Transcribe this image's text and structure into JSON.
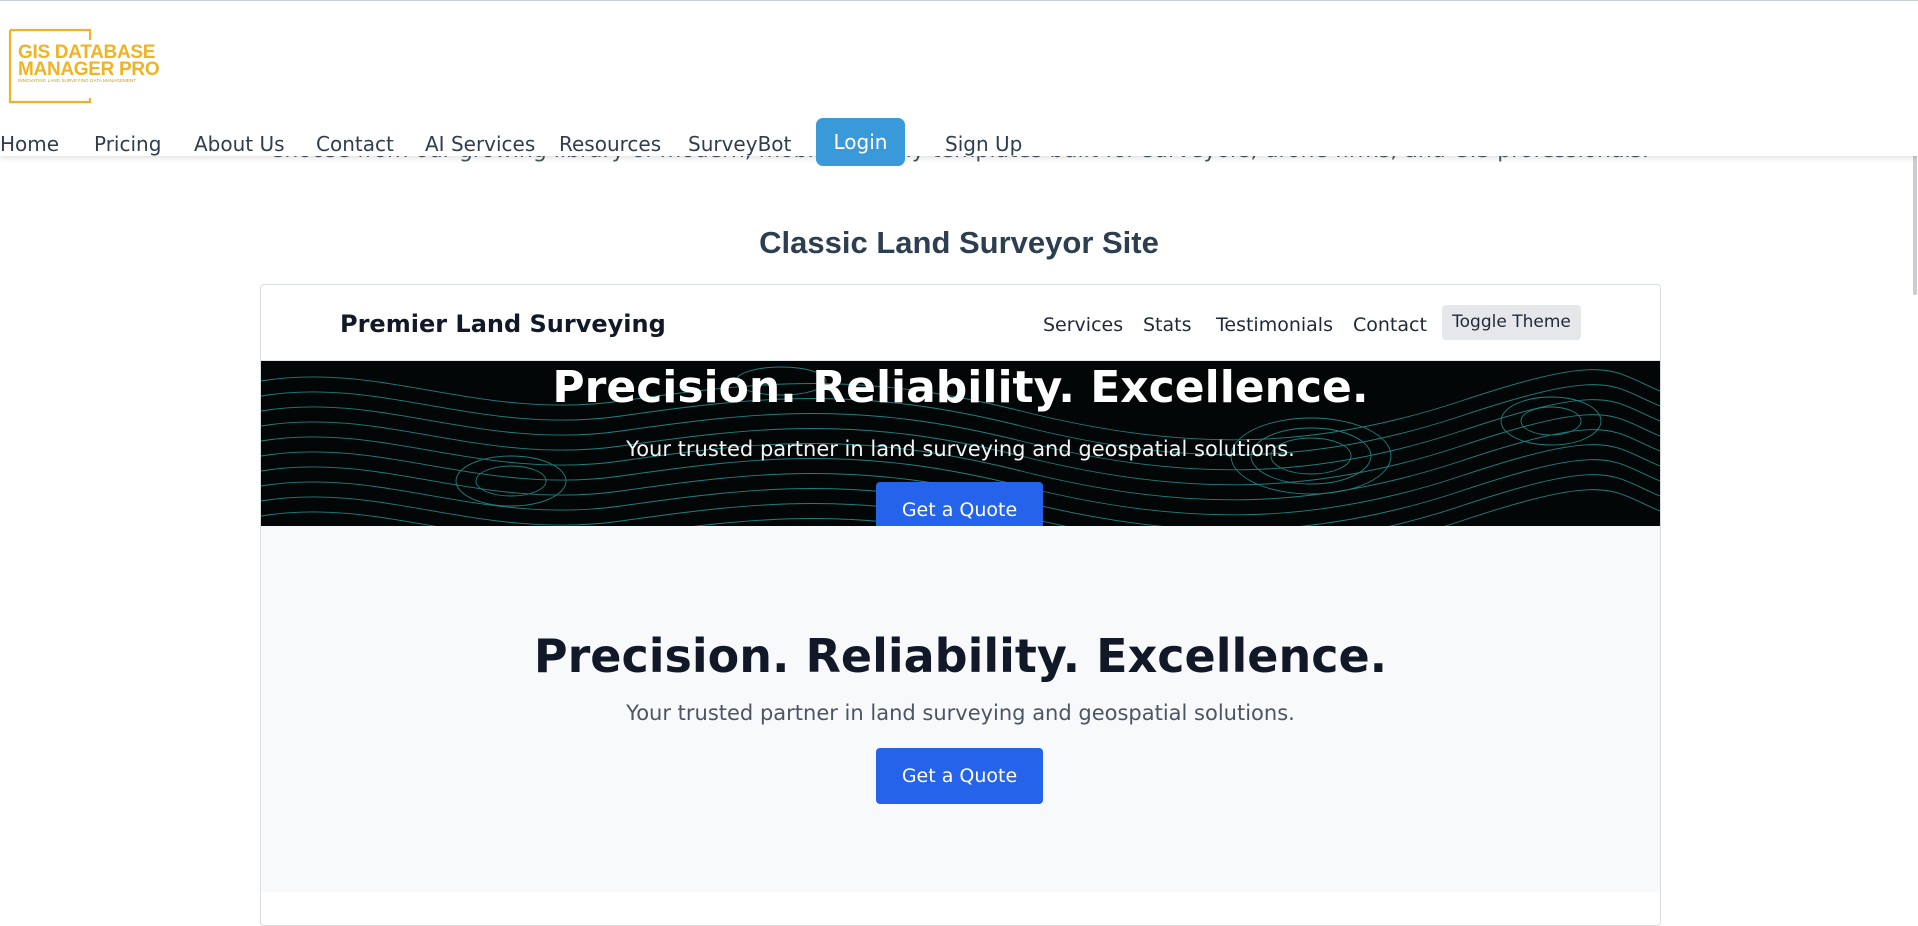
{
  "page": {
    "under_text": "Choose from our growing library of modern, mobile-friendly templates built for surveyors, drone firms, and GIS professionals.",
    "section_title": "Classic Land Surveyor Site"
  },
  "header": {
    "logo": {
      "line1": "GIS DATABASE",
      "line2": "MANAGER PRO",
      "tagline": "INNOVATING LAND SURVEYING DATA MANAGEMENT",
      "color": "#f0b323"
    },
    "nav": [
      {
        "label": "Home"
      },
      {
        "label": "Pricing"
      },
      {
        "label": "About Us"
      },
      {
        "label": "Contact"
      },
      {
        "label": "AI Services"
      },
      {
        "label": "Resources"
      },
      {
        "label": "SurveyBot"
      },
      {
        "label": "Login"
      },
      {
        "label": "Sign Up"
      }
    ],
    "login_color": "#3a9ad9"
  },
  "preview": {
    "brand": "Premier Land Surveying",
    "nav": [
      {
        "label": "Services"
      },
      {
        "label": "Stats"
      },
      {
        "label": "Testimonials"
      },
      {
        "label": "Contact"
      }
    ],
    "toggle_label": "Toggle Theme",
    "hero": {
      "title": "Precision. Reliability. Excellence.",
      "subtitle": "Your trusted partner in land surveying and geospatial solutions.",
      "cta": "Get a Quote",
      "contour_color": "#2aa8a8"
    },
    "section": {
      "title": "Precision. Reliability. Excellence.",
      "subtitle": "Your trusted partner in land surveying and geospatial solutions.",
      "cta": "Get a Quote"
    },
    "cta_color": "#2563eb"
  }
}
